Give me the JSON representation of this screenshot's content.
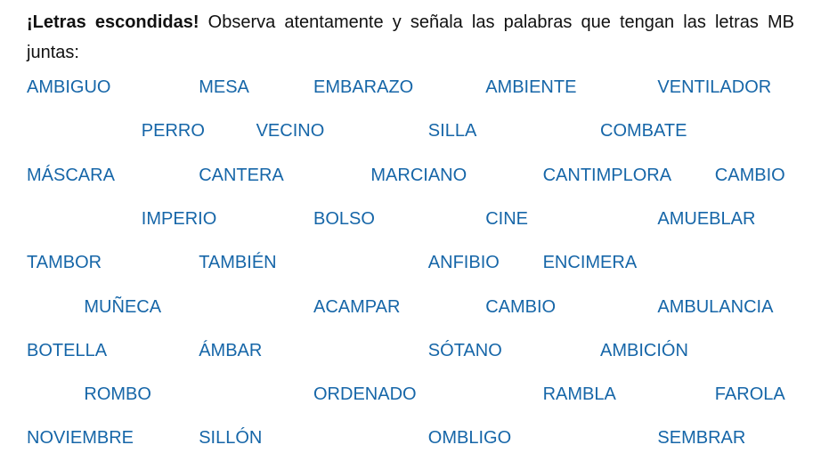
{
  "instructions": {
    "title": "¡Letras escondidas!",
    "text": " Observa atentamente y señala las palabras que tengan las letras MB juntas:"
  },
  "colors": {
    "text": "#111111",
    "word": "#1666a8"
  },
  "rows": [
    {
      "words": [
        {
          "text": "AMBIGUO",
          "col": 0
        },
        {
          "text": "MESA",
          "col": 3
        },
        {
          "text": "EMBARAZO",
          "col": 5
        },
        {
          "text": "AMBIENTE",
          "col": 8
        },
        {
          "text": "VENTILADOR",
          "col": 11
        }
      ]
    },
    {
      "words": [
        {
          "text": "PERRO",
          "col": 2
        },
        {
          "text": "VECINO",
          "col": 4
        },
        {
          "text": "SILLA",
          "col": 7
        },
        {
          "text": "COMBATE",
          "col": 10
        }
      ]
    },
    {
      "words": [
        {
          "text": "MÁSCARA",
          "col": 0
        },
        {
          "text": "CANTERA",
          "col": 3
        },
        {
          "text": "MARCIANO",
          "col": 6
        },
        {
          "text": "CANTIMPLORA",
          "col": 9
        },
        {
          "text": "CAMBIO",
          "col": 12
        }
      ]
    },
    {
      "words": [
        {
          "text": "IMPERIO",
          "col": 2
        },
        {
          "text": "BOLSO",
          "col": 5
        },
        {
          "text": "CINE",
          "col": 8
        },
        {
          "text": "AMUEBLAR",
          "col": 11
        }
      ]
    },
    {
      "words": [
        {
          "text": "TAMBOR",
          "col": 0
        },
        {
          "text": "TAMBIÉN",
          "col": 3
        },
        {
          "text": "ANFIBIO",
          "col": 7
        },
        {
          "text": "ENCIMERA",
          "col": 9
        }
      ]
    },
    {
      "words": [
        {
          "text": "MUÑECA",
          "col": 1
        },
        {
          "text": "ACAMPAR",
          "col": 5
        },
        {
          "text": "CAMBIO",
          "col": 8
        },
        {
          "text": "AMBULANCIA",
          "col": 11
        }
      ]
    },
    {
      "words": [
        {
          "text": "BOTELLA",
          "col": 0
        },
        {
          "text": "ÁMBAR",
          "col": 3
        },
        {
          "text": "SÓTANO",
          "col": 7
        },
        {
          "text": "AMBICIÓN",
          "col": 10
        }
      ]
    },
    {
      "words": [
        {
          "text": "ROMBO",
          "col": 1
        },
        {
          "text": "ORDENADO",
          "col": 5
        },
        {
          "text": "RAMBLA",
          "col": 9
        },
        {
          "text": "FAROLA",
          "col": 12
        }
      ]
    },
    {
      "words": [
        {
          "text": "NOVIEMBRE",
          "col": 0
        },
        {
          "text": "SILLÓN",
          "col": 3
        },
        {
          "text": "OMBLIGO",
          "col": 7
        },
        {
          "text": "SEMBRAR",
          "col": 11
        }
      ]
    }
  ]
}
